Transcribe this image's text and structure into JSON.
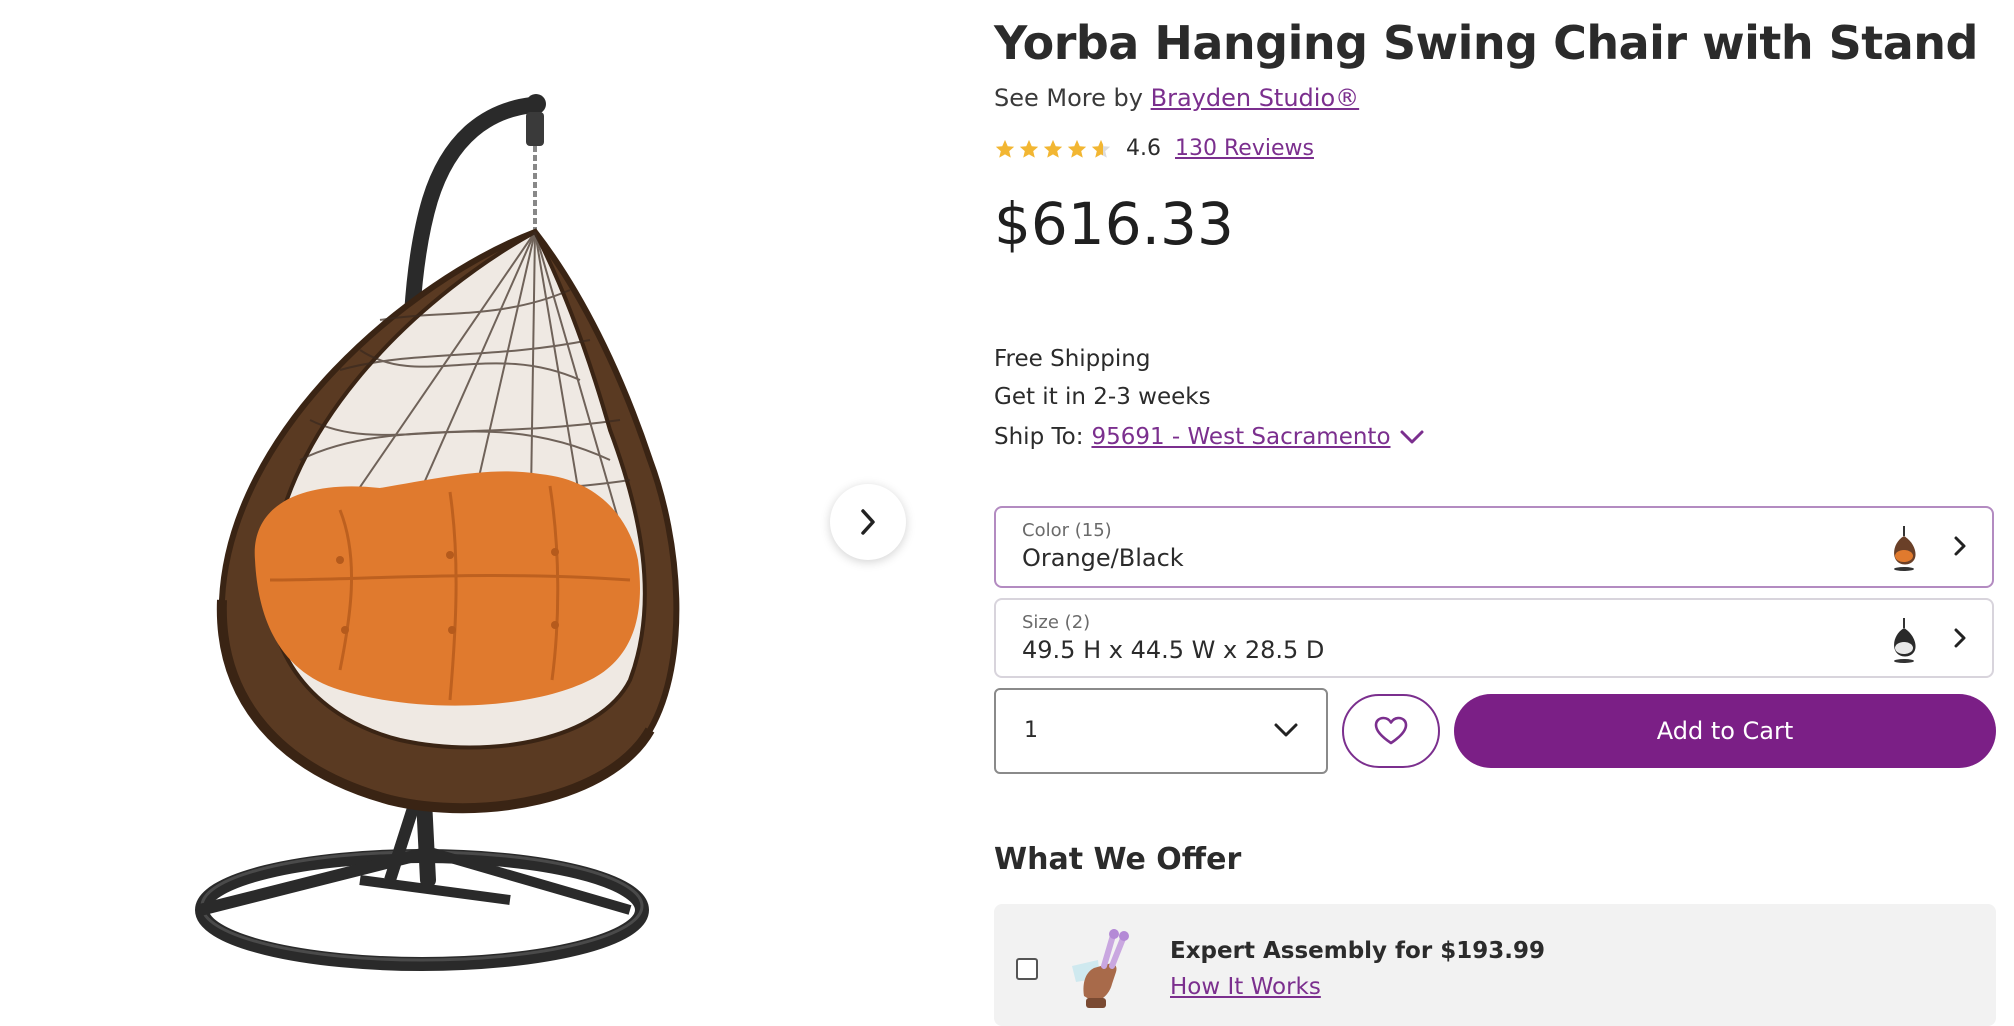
{
  "product": {
    "title": "Yorba Hanging Swing Chair with Stand",
    "see_more_prefix": "See More by",
    "brand": "Brayden Studio®",
    "rating": "4.6",
    "rating_value": 4.6,
    "reviews": "130 Reviews",
    "price": "$616.33"
  },
  "shipping": {
    "free": "Free Shipping",
    "eta": "Get it in 2-3 weeks",
    "ship_to_label": "Ship To:",
    "ship_to_location": "95691 - West Sacramento"
  },
  "options": {
    "color": {
      "label": "Color (15)",
      "value": "Orange/Black"
    },
    "size": {
      "label": "Size (2)",
      "value": "49.5 H x 44.5 W x 28.5 D"
    }
  },
  "purchase": {
    "quantity": "1",
    "add_to_cart": "Add to Cart"
  },
  "offer": {
    "heading": "What We Offer",
    "assembly_title": "Expert Assembly for $193.99",
    "how_it_works": "How It Works"
  },
  "icons": {
    "next": "chevron-right-icon",
    "dropdown": "chevron-down-icon",
    "favorite": "heart-icon",
    "star": "star-icon"
  },
  "colors": {
    "accent": "#7b1f86",
    "link": "#7b2f8e",
    "star": "#f2b632",
    "cushion": "#e07a2e"
  }
}
